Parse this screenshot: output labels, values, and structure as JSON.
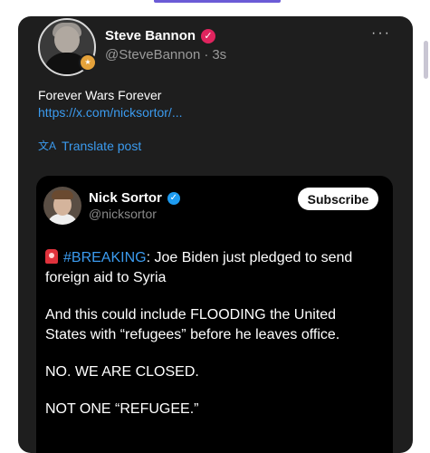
{
  "post": {
    "author_name": "Steve Bannon",
    "handle": "@SteveBannon",
    "separator": "·",
    "time": "3s",
    "text": "Forever Wars Forever",
    "link": "https://x.com/nicksortor/...",
    "translate_label": "Translate post",
    "more_label": "···"
  },
  "quote": {
    "author_name": "Nick Sortor",
    "handle": "@nicksortor",
    "subscribe_label": "Subscribe",
    "hashtag": "#BREAKING",
    "line1_rest": ": Joe Biden just pledged to send foreign aid to Syria",
    "para2": "And this could include FLOODING the United States with “refugees” before he leaves office.",
    "para3": "NO. WE ARE CLOSED.",
    "para4": "NOT ONE “REFUGEE.”"
  },
  "icons": {
    "verified_red": "✓",
    "verified_blue": "✓",
    "translate": "文A"
  },
  "colors": {
    "accent_blue": "#3b9bef",
    "card_bg": "#1e1e1e",
    "quote_bg": "#000000",
    "verified_red": "#e0245e",
    "verified_blue": "#1d9bf0"
  }
}
